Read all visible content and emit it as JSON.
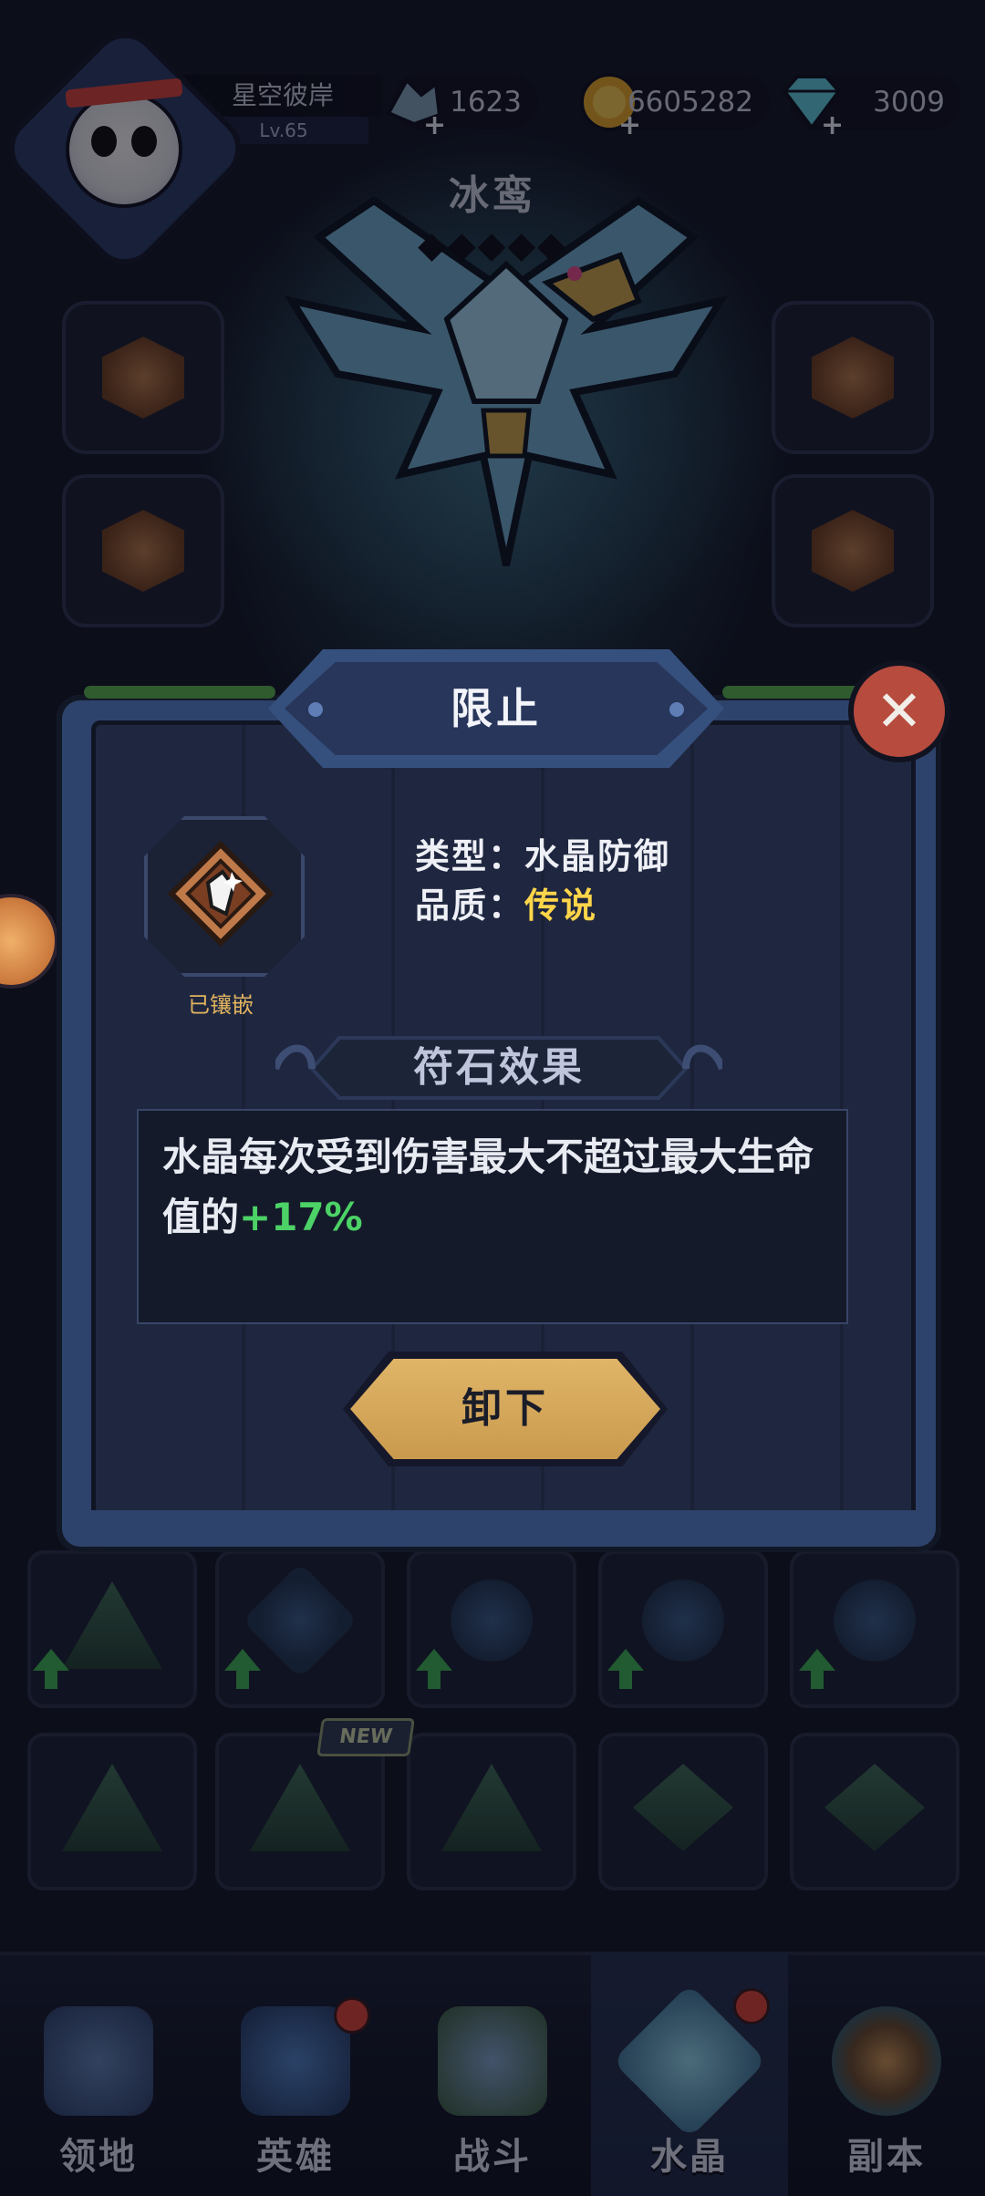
{
  "player": {
    "name": "星空彼岸",
    "level": "Lv.65",
    "level_progress": 0.15
  },
  "resources": [
    {
      "icon": "crystal-shard-icon",
      "value": "1623"
    },
    {
      "icon": "gold-coin-icon",
      "value": "6605282"
    },
    {
      "icon": "diamond-gem-icon",
      "value": "3009"
    }
  ],
  "hero": {
    "name": "冰鸾",
    "stars": "◆◆◆◆◆"
  },
  "modal": {
    "title": "限止",
    "status": "已镶嵌",
    "type_label": "类型：",
    "type_value": "水晶防御",
    "quality_label": "品质：",
    "quality_value": "传说",
    "section_title": "符石效果",
    "effect_text": "水晶每次受到伤害最大不超过最大生命值的",
    "effect_value": "+17%",
    "unequip_label": "卸下"
  },
  "grid": {
    "new_badge": "NEW"
  },
  "nav": {
    "items": [
      {
        "label": "领地",
        "icon": "territory-icon"
      },
      {
        "label": "英雄",
        "icon": "hero-icon"
      },
      {
        "label": "战斗",
        "icon": "battle-icon"
      },
      {
        "label": "水晶",
        "icon": "crystal-icon"
      },
      {
        "label": "副本",
        "icon": "dungeon-icon"
      }
    ],
    "active_index": 3
  },
  "colors": {
    "quality_legend": "#ffd54a",
    "effect_highlight": "#4cd266",
    "status_label": "#e2b45f",
    "unequip_button": "#d9ad60",
    "close_button": "#b74b3e"
  }
}
